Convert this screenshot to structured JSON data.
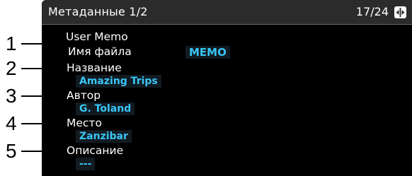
{
  "header": {
    "title": "Метаданные 1/2",
    "page_counter": "17/24",
    "nav_icon": "dial-icon"
  },
  "rows": [
    {
      "label": "User Memo"
    },
    {
      "label": "Имя файла",
      "value": "MEMO"
    },
    {
      "label": "Название",
      "value": "Amazing Trips"
    },
    {
      "label": "Автор",
      "value": "G. Toland"
    },
    {
      "label": "Место",
      "value": "Zanzibar"
    },
    {
      "label": "Описание",
      "value": "---"
    }
  ],
  "callouts": [
    "1",
    "2",
    "3",
    "4",
    "5"
  ],
  "colors": {
    "screen_bg": "#000000",
    "header_bg": "#2b2b2b",
    "label_text": "#ffffff",
    "value_text": "#38c6f4",
    "callout": "#000000"
  }
}
